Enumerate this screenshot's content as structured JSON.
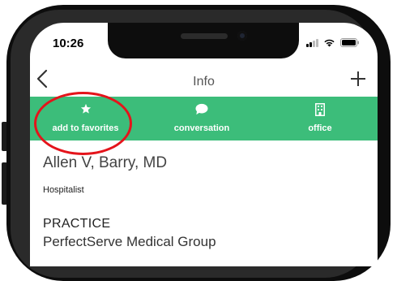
{
  "status_bar": {
    "time": "10:26"
  },
  "nav": {
    "back_icon": "chevron-left-icon",
    "title": "Info",
    "add_icon": "plus-icon"
  },
  "actions": [
    {
      "label": "add to favorites",
      "icon": "star-icon"
    },
    {
      "label": "conversation",
      "icon": "chat-bubble-icon"
    },
    {
      "label": "office",
      "icon": "building-icon"
    }
  ],
  "contact": {
    "name": "Allen V, Barry, MD",
    "role": "Hospitalist",
    "practice_heading": "PRACTICE",
    "practice_name": "PerfectServe Medical Group"
  },
  "colors": {
    "accent": "#3cbd7a",
    "highlight_ring": "#e4141b"
  }
}
